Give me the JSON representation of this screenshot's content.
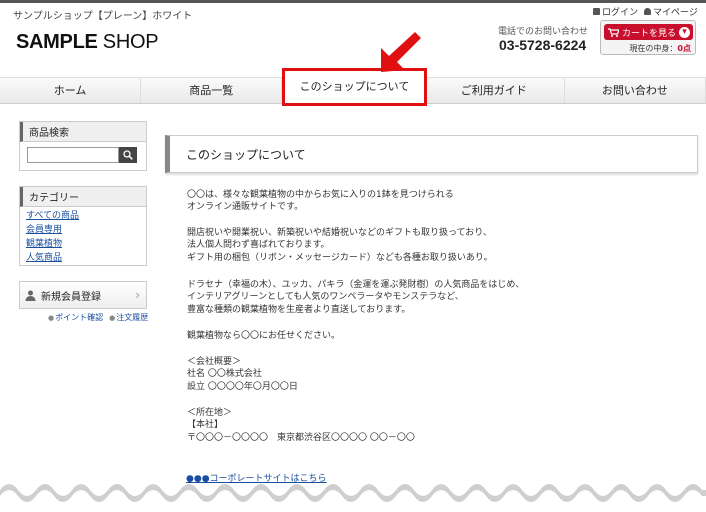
{
  "header": {
    "shop_name": "サンプルショップ【プレーン】ホワイト",
    "logo_bold": "SAMPLE",
    "logo_light": " SHOP",
    "phone_label": "電話でのお問い合わせ",
    "phone": "03-5728-6224",
    "login": "ログイン",
    "mypage": "マイページ",
    "cart_button": "カートを見る",
    "cart_contents_label": "現在の中身：",
    "cart_contents_value": "0点"
  },
  "nav": {
    "items": [
      "ホーム",
      "商品一覧",
      "このショップについて",
      "ご利用ガイド",
      "お問い合わせ"
    ]
  },
  "sidebar": {
    "search_title": "商品検索",
    "search_placeholder": "",
    "category_title": "カテゴリー",
    "categories": [
      "すべての商品",
      "会員専用",
      "観葉植物",
      "人気商品"
    ],
    "member_register": "新規会員登録",
    "point_link": "ポイント確認",
    "order_link": "注文履歴"
  },
  "content": {
    "title": "このショップについて",
    "p1": "〇〇は、様々な観葉植物の中からお気に入りの1鉢を見つけられる\nオンライン通販サイトです。",
    "p2": "開店祝いや開業祝い、新築祝いや結婚祝いなどのギフトも取り扱っており、\n法人個人問わず喜ばれております。\nギフト用の梱包（リボン・メッセージカード）なども各種お取り扱いあり。",
    "p3": "ドラセナ（幸福の木）、ユッカ、パキラ（金運を運ぶ発財樹）の人気商品をはじめ、\nインテリアグリーンとしても人気のワンペラータやモンステラなど、\n豊富な種類の観葉植物を生産者より直送しております。",
    "p4": "観葉植物なら〇〇にお任せください。",
    "p5": "＜会社概要＞\n社名 〇〇株式会社\n設立 〇〇〇〇年〇月〇〇日",
    "p6": "＜所在地＞\n【本社】\n〒〇〇〇－〇〇〇〇　東京都渋谷区〇〇〇〇 〇〇－〇〇",
    "corp_link": "●●●コーポレートサイトはこちら"
  },
  "colors": {
    "accent": "#c8102e",
    "highlight": "#e01010",
    "link": "#1a4fa0"
  }
}
